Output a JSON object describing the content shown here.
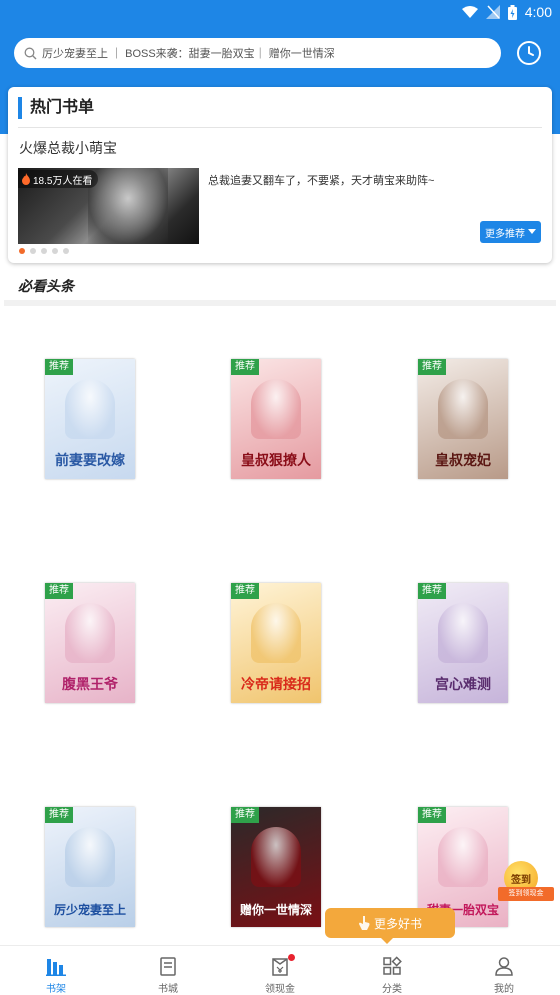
{
  "status_bar": {
    "time": "4:00"
  },
  "search": {
    "text": "厉少宠妻至上 ｜ BOSS来袭：甜妻一胎双宝｜ 赠你一世情深"
  },
  "hot": {
    "title": "热门书单",
    "book_name": "火爆总裁小萌宝",
    "viewers": "18.5万人在看",
    "description": "总裁追妻又翻车了，不要紧，天才萌宝来助阵~",
    "more_label": "更多推荐",
    "carousel_count": 5,
    "carousel_active": 0
  },
  "headline": {
    "title": "必看头条"
  },
  "books": [
    {
      "tag": "推荐",
      "cover_title": "前妻要改嫁",
      "palette": [
        "#eef4fb",
        "#c7d9ef"
      ],
      "text_color": "#2b5aa5"
    },
    {
      "tag": "推荐",
      "cover_title": "皇叔狠撩人",
      "palette": [
        "#fbe6e6",
        "#e59aa0"
      ],
      "text_color": "#8a0d18"
    },
    {
      "tag": "推荐",
      "cover_title": "皇叔宠妃",
      "palette": [
        "#f3ece7",
        "#b89a88"
      ],
      "text_color": "#5a1612"
    },
    {
      "tag": "推荐",
      "cover_title": "腹黑王爷",
      "palette": [
        "#fbeef3",
        "#e7b3c8"
      ],
      "text_color": "#b0226a"
    },
    {
      "tag": "推荐",
      "cover_title": "冷帝请接招",
      "palette": [
        "#fff4d8",
        "#f0c46d"
      ],
      "text_color": "#d92b1b"
    },
    {
      "tag": "推荐",
      "cover_title": "宫心难测",
      "palette": [
        "#f1ecf6",
        "#c6b4da"
      ],
      "text_color": "#5a2d6e"
    },
    {
      "tag": "推荐",
      "cover_title": "厉少宠妻至上",
      "palette": [
        "#eef3fb",
        "#b9cfe8"
      ],
      "text_color": "#1d4fa0"
    },
    {
      "tag": "推荐",
      "cover_title": "赠你一世情深",
      "palette": [
        "#2a2a2a",
        "#7a0f14"
      ],
      "text_color": "#ffffff"
    },
    {
      "tag": "推荐",
      "cover_title": "甜妻一胎双宝",
      "palette": [
        "#fdeff3",
        "#eab1c4"
      ],
      "text_color": "#c2185b"
    }
  ],
  "floating": {
    "more_books": "更多好书",
    "signin_title": "签到",
    "signin_sub": "签到领现金"
  },
  "tabs": [
    {
      "label": "书架",
      "icon": "bookshelf-icon",
      "active": true
    },
    {
      "label": "书城",
      "icon": "bookstore-icon",
      "active": false
    },
    {
      "label": "领现金",
      "icon": "cash-icon",
      "active": false,
      "badge": true
    },
    {
      "label": "分类",
      "icon": "category-icon",
      "active": false
    },
    {
      "label": "我的",
      "icon": "user-icon",
      "active": false
    }
  ],
  "colors": {
    "primary": "#1e86e6",
    "tag_green": "#2fa14a",
    "accent_orange": "#f3a83c"
  }
}
